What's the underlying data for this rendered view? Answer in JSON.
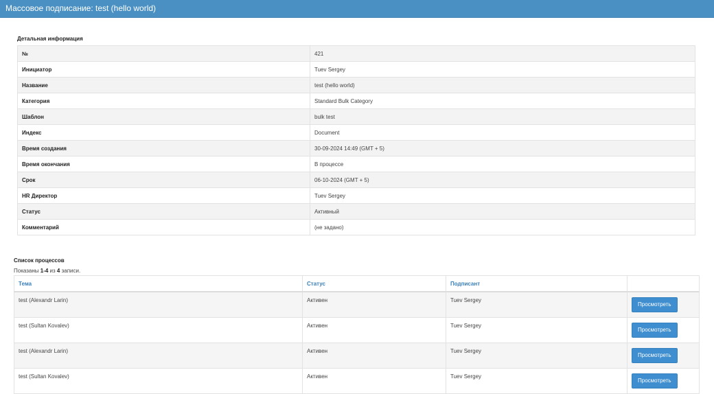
{
  "header": {
    "title": "Массовое подписание: test (hello world)"
  },
  "details": {
    "title": "Детальная информация",
    "rows": [
      {
        "label": "№",
        "value": "421"
      },
      {
        "label": "Инициатор",
        "value": "Tuev Sergey"
      },
      {
        "label": "Название",
        "value": "test (hello world)"
      },
      {
        "label": "Категория",
        "value": "Standard Bulk Category"
      },
      {
        "label": "Шаблон",
        "value": "bulk test"
      },
      {
        "label": "Индекс",
        "value": "Document"
      },
      {
        "label": "Время создания",
        "value": "30-09-2024 14:49 (GMT + 5)"
      },
      {
        "label": "Время окончания",
        "value": "В процессе"
      },
      {
        "label": "Срок",
        "value": "06-10-2024 (GMT + 5)"
      },
      {
        "label": "HR Директор",
        "value": "Tuev Sergey"
      },
      {
        "label": "Статус",
        "value": "Активный"
      },
      {
        "label": "Комментарий",
        "value": "(не задано)"
      }
    ]
  },
  "processes": {
    "title": "Список процессов",
    "summary": {
      "prefix": "Показаны ",
      "range": "1-4",
      "middle": " из ",
      "total": "4",
      "suffix": " записи."
    },
    "columns": {
      "subject": "Тема",
      "status": "Статус",
      "signer": "Подписант"
    },
    "view_label": "Просмотреть",
    "rows": [
      {
        "subject": "test (Alexandr Larin)",
        "status": "Активен",
        "signer": "Tuev Sergey"
      },
      {
        "subject": "test (Sultan Kovalev)",
        "status": "Активен",
        "signer": "Tuev Sergey"
      },
      {
        "subject": "test (Alexandr Larin)",
        "status": "Активен",
        "signer": "Tuev Sergey"
      },
      {
        "subject": "test (Sultan Kovalev)",
        "status": "Активен",
        "signer": "Tuev Sergey"
      }
    ]
  }
}
